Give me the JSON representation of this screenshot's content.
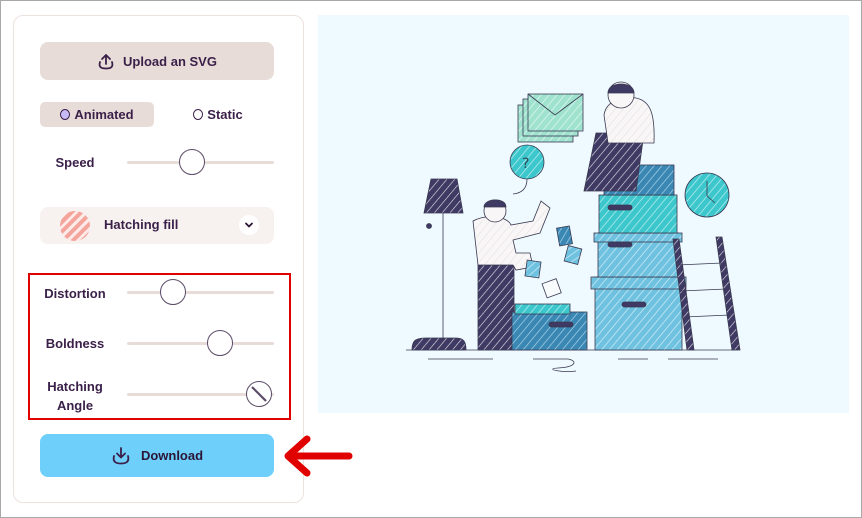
{
  "controls": {
    "upload_label": "Upload an SVG",
    "modes": [
      {
        "label": "Animated",
        "selected": true
      },
      {
        "label": "Static",
        "selected": false
      }
    ],
    "speed": {
      "label": "Speed",
      "value": 0.44
    },
    "fill_select": {
      "selected": "Hatching fill"
    },
    "distortion": {
      "label": "Distortion",
      "value": 0.31
    },
    "boldness": {
      "label": "Boldness",
      "value": 0.63
    },
    "hatching_angle": {
      "label_line1": "Hatching",
      "label_line2": "Angle",
      "value": 0.9
    },
    "download_label": "Download"
  },
  "annotations": {
    "highlight_box_color": "#e00000",
    "arrow_color": "#e00000"
  },
  "colors": {
    "accent_button": "#6ecffb",
    "secondary_button": "#e8dcd8",
    "text": "#3a1f48",
    "preview_bg": "#eefaff"
  },
  "preview": {
    "description": "Hand-drawn hatched illustration: two people with stacked boxes, lamp, ladder, clock, envelopes, question bubble"
  }
}
